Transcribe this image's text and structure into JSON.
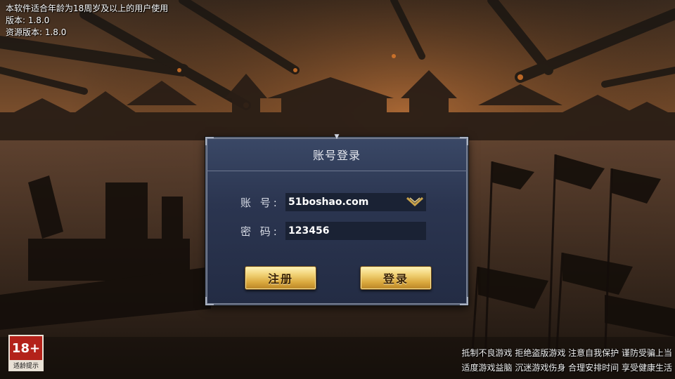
{
  "top_info": {
    "age_notice": "本软件适合年龄为18周岁及以上的用户使用",
    "version": "版本: 1.8.0",
    "resource_version": "资源版本: 1.8.0"
  },
  "login": {
    "title": "账号登录",
    "account_label": "账 号:",
    "account_value": "51boshao.com",
    "password_label": "密 码:",
    "password_value": "123456",
    "register_button": "注册",
    "login_button": "登录",
    "dropdown_icon": "chevron-down-icon"
  },
  "age_badge": {
    "rating": "18+",
    "caption": "适龄提示"
  },
  "health_notice": {
    "line1": "抵制不良游戏  拒绝盗版游戏  注意自我保护  谨防受骗上当",
    "line2": "适度游戏益脑  沉迷游戏伤身  合理安排时间  享受健康生活"
  },
  "colors": {
    "panel_bg": "#2b3550",
    "button_gold": "#f1d276",
    "badge_red": "#b3221a"
  }
}
